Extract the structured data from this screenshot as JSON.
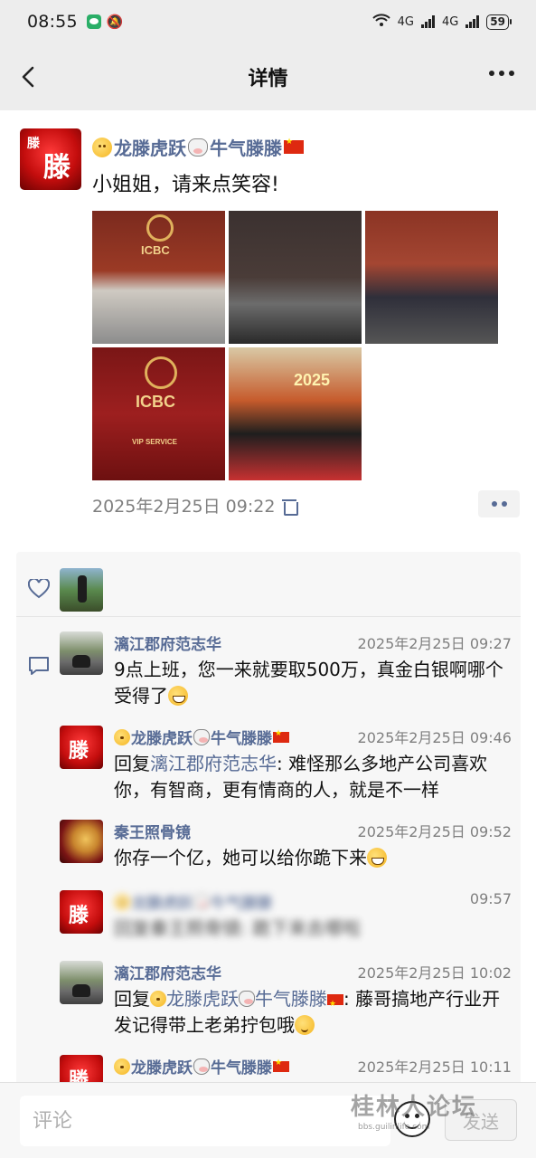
{
  "status_bar": {
    "time": "08:55",
    "network_1": "4G",
    "network_2": "4G",
    "battery": "59"
  },
  "nav": {
    "title": "详情"
  },
  "post": {
    "author": "龙滕虎跃",
    "author_suffix": "牛气滕滕",
    "text": "小姐姐，请来点笑容!",
    "photo_texts": {
      "icbc_1": "ICBC",
      "icbc_2": "ICBC",
      "vip_service": "VIP SERVICE",
      "banner_2025": "2025"
    },
    "time": "2025年2月25日 09:22"
  },
  "comments": [
    {
      "name": "漓江郡府范志华",
      "time": "2025年2月25日 09:27",
      "text": "9点上班，您一来就要取500万，真金白银啊哪个受得了"
    },
    {
      "name": "龙滕虎跃",
      "name_suffix": "牛气滕滕",
      "time": "2025年2月25日 09:46",
      "reply_prefix": "回复",
      "reply_to": "漓江郡府范志华",
      "text": ": 难怪那么多地产公司喜欢你，有智商，更有情商的人，就是不一样"
    },
    {
      "name": "秦王照骨镜",
      "time": "2025年2月25日 09:52",
      "text": "你存一个亿，她可以给你跪下来"
    },
    {
      "name": "龙滕虎跃",
      "name_suffix": "牛气滕滕",
      "time": "09:57",
      "text": "回复秦王照骨镜: 跪下来去哪啦"
    },
    {
      "name": "漓江郡府范志华",
      "time": "2025年2月25日 10:02",
      "reply_prefix": "回复",
      "reply_to": "龙滕虎跃",
      "reply_to_suffix": "牛气滕滕",
      "text": ": 藤哥搞地产行业开发记得带上老弟拧包哦"
    },
    {
      "name": "龙滕虎跃",
      "name_suffix": "牛气滕滕",
      "time": "2025年2月25日 10:11"
    }
  ],
  "bottom": {
    "placeholder": "评论",
    "send_label": "发送",
    "watermark": "桂林人论坛",
    "watermark_sub": "bbs.guilinlife.com"
  }
}
